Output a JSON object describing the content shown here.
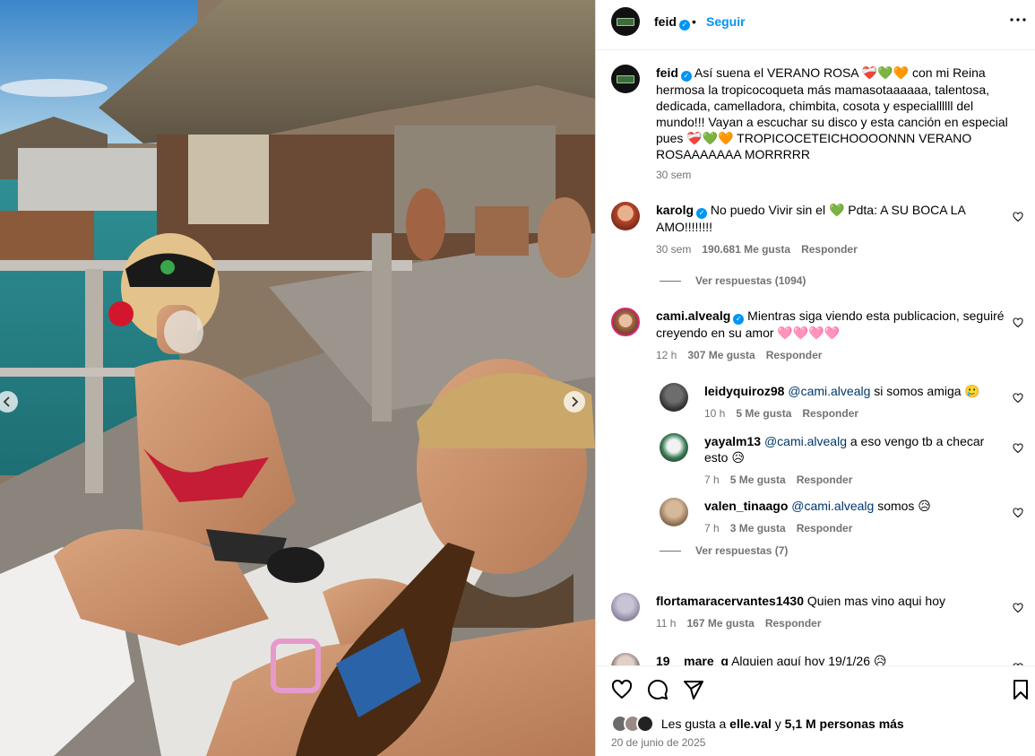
{
  "header": {
    "username": "feid",
    "separator": "•",
    "follow_label": "Seguir"
  },
  "caption": {
    "username": "feid",
    "text": "Así suena el VERANO ROSA ❤️‍🩹💚🧡 con mi Reina hermosa la tropicocoqueta más mamasotaaaaaa, talentosa, dedicada, camelladora, chimbita, cosota y especiallllll del mundo!!! Vayan a escuchar su disco y esta canción en especial pues ❤️‍🩹💚🧡 TROPICOCETEICHOOOONNN VERANO ROSAAAAAAA MORRRRR",
    "time": "30 sem"
  },
  "comments": [
    {
      "username": "karolg",
      "text": "No puedo Vivir sin el 💚 Pdta: A SU BOCA LA AMO!!!!!!!!",
      "time": "30 sem",
      "likes": "190.681 Me gusta",
      "reply": "Responder",
      "view_replies": "Ver respuestas (1094)"
    },
    {
      "username": "cami.alvealg",
      "text": "Mientras siga viendo esta publicacion, seguiré creyendo en su amor 🩷🩷🩷🩷",
      "time": "12 h",
      "likes": "307 Me gusta",
      "reply": "Responder",
      "view_replies": "Ver respuestas (7)",
      "replies": [
        {
          "username": "leidyquiroz98",
          "mention": "@cami.alvealg",
          "text": "si somos amiga 🥲",
          "time": "10 h",
          "likes": "5 Me gusta",
          "reply": "Responder"
        },
        {
          "username": "yayalm13",
          "mention": "@cami.alvealg",
          "text": "a eso vengo tb a checar esto 😥",
          "time": "7 h",
          "likes": "5 Me gusta",
          "reply": "Responder"
        },
        {
          "username": "valen_tinaago",
          "mention": "@cami.alvealg",
          "text": "somos 😥",
          "time": "7 h",
          "likes": "3 Me gusta",
          "reply": "Responder"
        }
      ]
    },
    {
      "username": "flortamaracervantes1430",
      "text": "Quien mas vino aqui hoy",
      "time": "11 h",
      "likes": "167 Me gusta",
      "reply": "Responder"
    },
    {
      "username": "19__mare_g",
      "text": "Alguien aquí hoy 19/1/26 😥"
    }
  ],
  "footer": {
    "likes_prefix": "Les gusta a",
    "likes_user": "elle.val",
    "likes_conj": "y",
    "likes_count": "5,1 M personas más",
    "date": "20 de junio de 2025"
  },
  "icons": [
    "verified-badge-icon",
    "more-options-icon",
    "heart-icon",
    "comment-icon",
    "share-icon",
    "bookmark-icon",
    "chevron-left-icon",
    "chevron-right-icon"
  ],
  "colors": {
    "accent": "#0095f6",
    "muted": "#737373",
    "mention": "#00376b"
  }
}
